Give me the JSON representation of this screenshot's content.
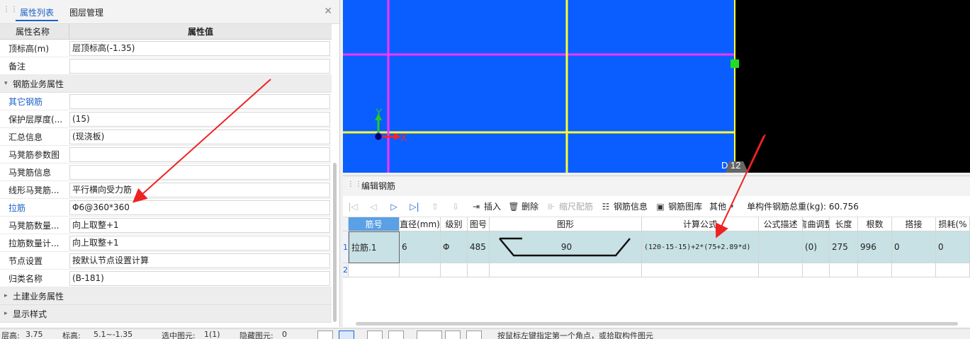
{
  "left_panel": {
    "tabs": [
      "属性列表",
      "图层管理"
    ],
    "header": {
      "name_col": "属性名称",
      "value_col": "属性值"
    },
    "rows_top": [
      {
        "name": "顶标高(m)",
        "value": "层顶标高(-1.35)"
      },
      {
        "name": "备注",
        "value": ""
      }
    ],
    "group_rebar": "钢筋业务属性",
    "rows_rebar": [
      {
        "name": "其它钢筋",
        "value": ""
      },
      {
        "name": "保护层厚度(...",
        "value": "(15)"
      },
      {
        "name": "汇总信息",
        "value": "(现浇板)"
      },
      {
        "name": "马凳筋参数图",
        "value": ""
      },
      {
        "name": "马凳筋信息",
        "value": ""
      },
      {
        "name": "线形马凳筋...",
        "value": "平行横向受力筋"
      },
      {
        "name": "拉筋",
        "value": "Φ6@360*360"
      },
      {
        "name": "马凳筋数量...",
        "value": "向上取整+1"
      },
      {
        "name": "拉筋数量计...",
        "value": "向上取整+1"
      },
      {
        "name": "节点设置",
        "value": "按默认节点设置计算"
      },
      {
        "name": "归类名称",
        "value": "(B-181)"
      }
    ],
    "group_civil": "土建业务属性",
    "group_display": "显示样式"
  },
  "cad": {
    "axis_y": "Y",
    "axis_x": "X",
    "label": "D 12"
  },
  "editor": {
    "title": "编辑钢筋",
    "toolbar": {
      "insert": "插入",
      "delete": "删除",
      "scale": "缩尺配筋",
      "info": "钢筋信息",
      "library": "钢筋图库",
      "other": "其他",
      "weight_label": "单构件钢筋总重(kg):",
      "weight_value": "60.756"
    },
    "columns": [
      "筋号",
      "直径(mm)",
      "级别",
      "图号",
      "图形",
      "计算公式",
      "公式描述",
      "弯曲调整",
      "长度",
      "根数",
      "搭接",
      "损耗(%"
    ],
    "rows": [
      {
        "num": "1",
        "bar": "拉筋.1",
        "diameter": "6",
        "grade": "Φ",
        "fig": "485",
        "shape_value": "90",
        "formula": "(120-15-15)+2*(75+2.89*d)",
        "desc": "",
        "bend": "(0)",
        "length": "275",
        "count": "996",
        "lap": "0",
        "loss": "0"
      }
    ],
    "empty_row_num": "2"
  },
  "status": {
    "text1": "层高:",
    "val1": "3.75",
    "text2": "标高:",
    "val2": "5.1~-1.35",
    "text3": "选中图元:",
    "val3": "1(1)",
    "text4": "隐藏图元:",
    "val4": "0",
    "hint": "按鼠标左键指定第一个角点，或拾取构件图元"
  }
}
